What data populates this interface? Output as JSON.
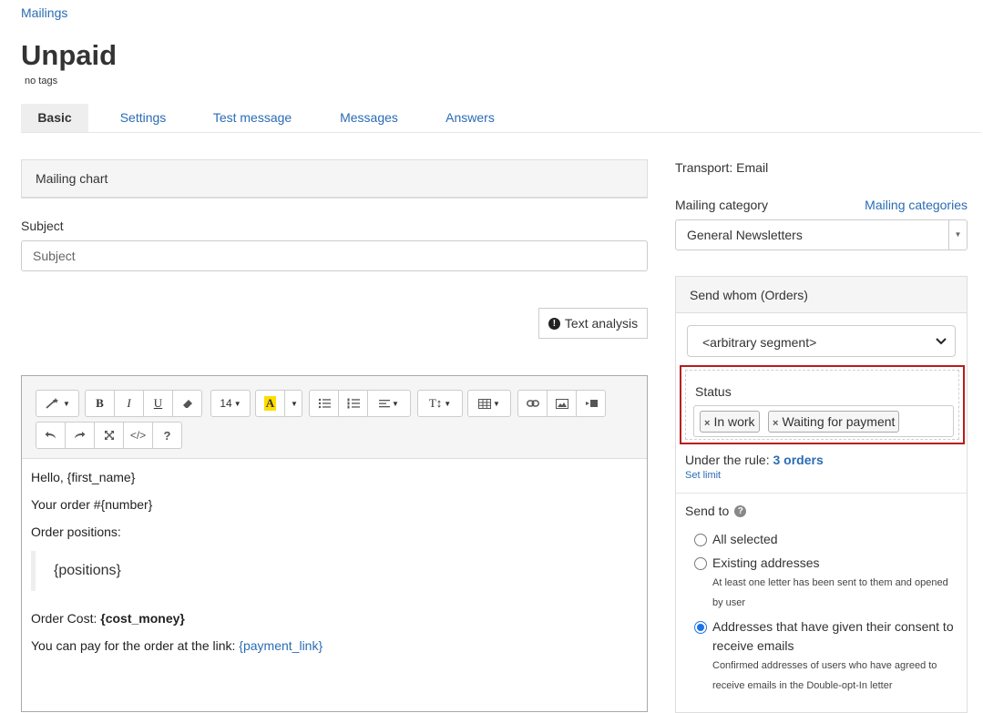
{
  "breadcrumb": "Mailings",
  "title": "Unpaid",
  "tags": "no tags",
  "tabs": [
    {
      "label": "Basic"
    },
    {
      "label": "Settings"
    },
    {
      "label": "Test message"
    },
    {
      "label": "Messages"
    },
    {
      "label": "Answers"
    }
  ],
  "chart_panel": "Mailing chart",
  "subject": {
    "label": "Subject",
    "placeholder": "Subject",
    "value": ""
  },
  "text_analysis": "Text analysis",
  "toolbar": {
    "font_size": "14",
    "highlight": "A",
    "help": "?",
    "code": "</>",
    "bold": "B",
    "italic": "I",
    "underline": "U",
    "text_size": "T↕"
  },
  "editor": {
    "line1": "Hello, {first_name}",
    "line2": "Your order #{number}",
    "line3": "Order positions:",
    "quote": "{positions}",
    "cost_prefix": "Order Cost: ",
    "cost_value": "{cost_money}",
    "pay_prefix": "You can pay for the order at the link: ",
    "pay_link": "{payment_link}"
  },
  "transport": "Transport: Email",
  "category": {
    "label": "Mailing category",
    "link": "Mailing categories",
    "value": "General Newsletters"
  },
  "send_panel": {
    "title": "Send whom (Orders)",
    "segment": "<arbitrary segment>",
    "status_label": "Status",
    "chips": [
      "In work",
      "Waiting for payment"
    ],
    "rule_prefix": "Under the rule: ",
    "rule_count": "3 orders",
    "set_limit": "Set limit",
    "send_to": "Send to",
    "options": [
      {
        "label": "All selected",
        "hint": "",
        "selected": false
      },
      {
        "label": "Existing addresses",
        "hint": "At least one letter has been sent to them and opened by user",
        "selected": false
      },
      {
        "label": "Addresses that have given their consent to receive emails",
        "hint": "Confirmed addresses of users who have agreed to receive emails in the Double-opt-In letter",
        "selected": true
      }
    ]
  },
  "colors": {
    "link": "#2a6cb4",
    "highlight_box": "#b91c1c",
    "radio": "#1a73e8"
  }
}
